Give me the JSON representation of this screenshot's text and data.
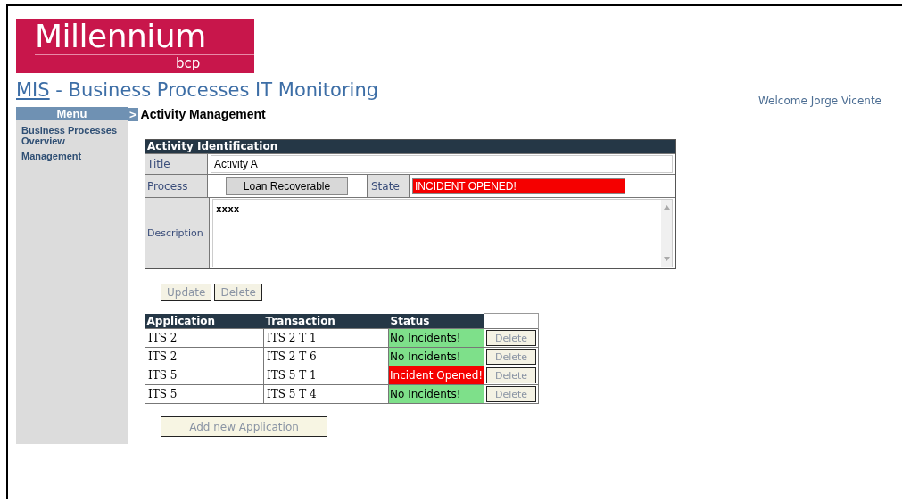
{
  "logo": {
    "name": "Millennium",
    "sub": "bcp"
  },
  "header": {
    "link": "MIS",
    "title": " - Business Processes IT Monitoring",
    "welcome": "Welcome Jorge Vicente"
  },
  "menu": {
    "title": "Menu",
    "items": [
      {
        "label": "Business Processes Overview"
      },
      {
        "label": "Management"
      }
    ]
  },
  "breadcrumb": {
    "marker": ">",
    "title": "Activity Management"
  },
  "activity": {
    "heading": "Activity Identification",
    "title_label": "Title",
    "title_value": "Activity A",
    "process_label": "Process",
    "process_value": "Loan Recoverable",
    "state_label": "State",
    "state_value": "INCIDENT OPENED!",
    "description_label": "Description",
    "description_value": "xxxx"
  },
  "actions": [
    "Update",
    "Delete"
  ],
  "table": {
    "columns": [
      "Application",
      "Transaction",
      "Status"
    ],
    "rows": [
      {
        "application": "ITS 2",
        "transaction": "ITS 2 T 1",
        "status": "No Incidents!",
        "kind": "ok",
        "action": "Delete"
      },
      {
        "application": "ITS 2",
        "transaction": "ITS 2 T 6",
        "status": "No Incidents!",
        "kind": "ok",
        "action": "Delete"
      },
      {
        "application": "ITS 5",
        "transaction": "ITS 5 T 1",
        "status": "Incident Opened!",
        "kind": "incident",
        "action": "Delete"
      },
      {
        "application": "ITS 5",
        "transaction": "ITS 5 T 4",
        "status": "No Incidents!",
        "kind": "ok",
        "action": "Delete"
      }
    ]
  },
  "add_button": "Add new Application"
}
